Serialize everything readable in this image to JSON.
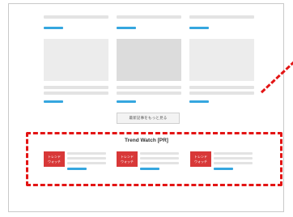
{
  "load_more_label": "最新記事をもっと見る",
  "trend": {
    "title": "Trend Watch [PR]",
    "thumb_text": "トレンド\nウォッチ"
  },
  "colors": {
    "accent_blue": "#35a6df",
    "highlight_red": "#e31414",
    "trend_thumb": "#d83838"
  }
}
